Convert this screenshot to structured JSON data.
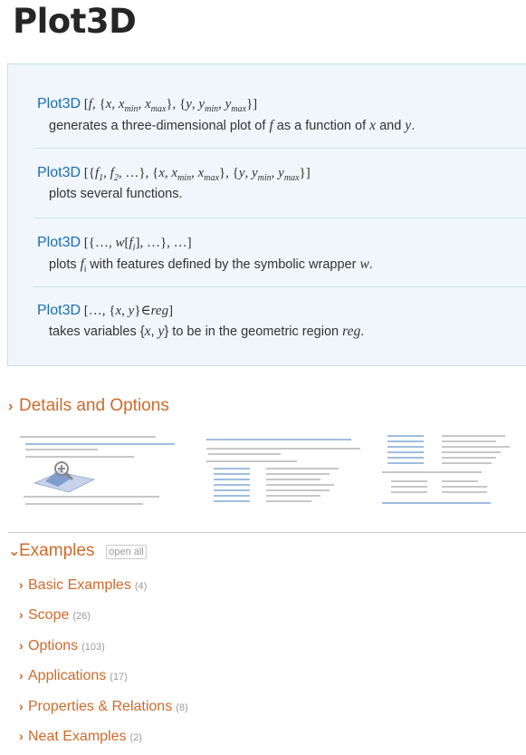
{
  "page": {
    "title": "Plot3D"
  },
  "usages": [
    {
      "fn": "Plot3D",
      "desc": "generates a three-dimensional plot of f as a function of x and y."
    },
    {
      "fn": "Plot3D",
      "desc": "plots several functions."
    },
    {
      "fn": "Plot3D",
      "desc": "plots fi with features defined by the symbolic wrapper w."
    },
    {
      "fn": "Plot3D",
      "desc": "takes variables {x, y} to be in the geometric region reg."
    }
  ],
  "details": {
    "label": "Details and Options",
    "icon": "chevron-right-icon",
    "zoom_icon": "magnifier-plus-icon"
  },
  "examples": {
    "label": "Examples",
    "icon": "chevron-down-icon",
    "open_all": "open all",
    "items": [
      {
        "label": "Basic Examples",
        "count": "(4)"
      },
      {
        "label": "Scope",
        "count": "(26)"
      },
      {
        "label": "Options",
        "count": "(103)"
      },
      {
        "label": "Applications",
        "count": "(17)"
      },
      {
        "label": "Properties & Relations",
        "count": "(8)"
      },
      {
        "label": "Neat Examples",
        "count": "(2)"
      }
    ]
  },
  "colors": {
    "link": "#1a6db3",
    "accent": "#cf6a2a",
    "usage_bg": "#f0f6fb"
  }
}
